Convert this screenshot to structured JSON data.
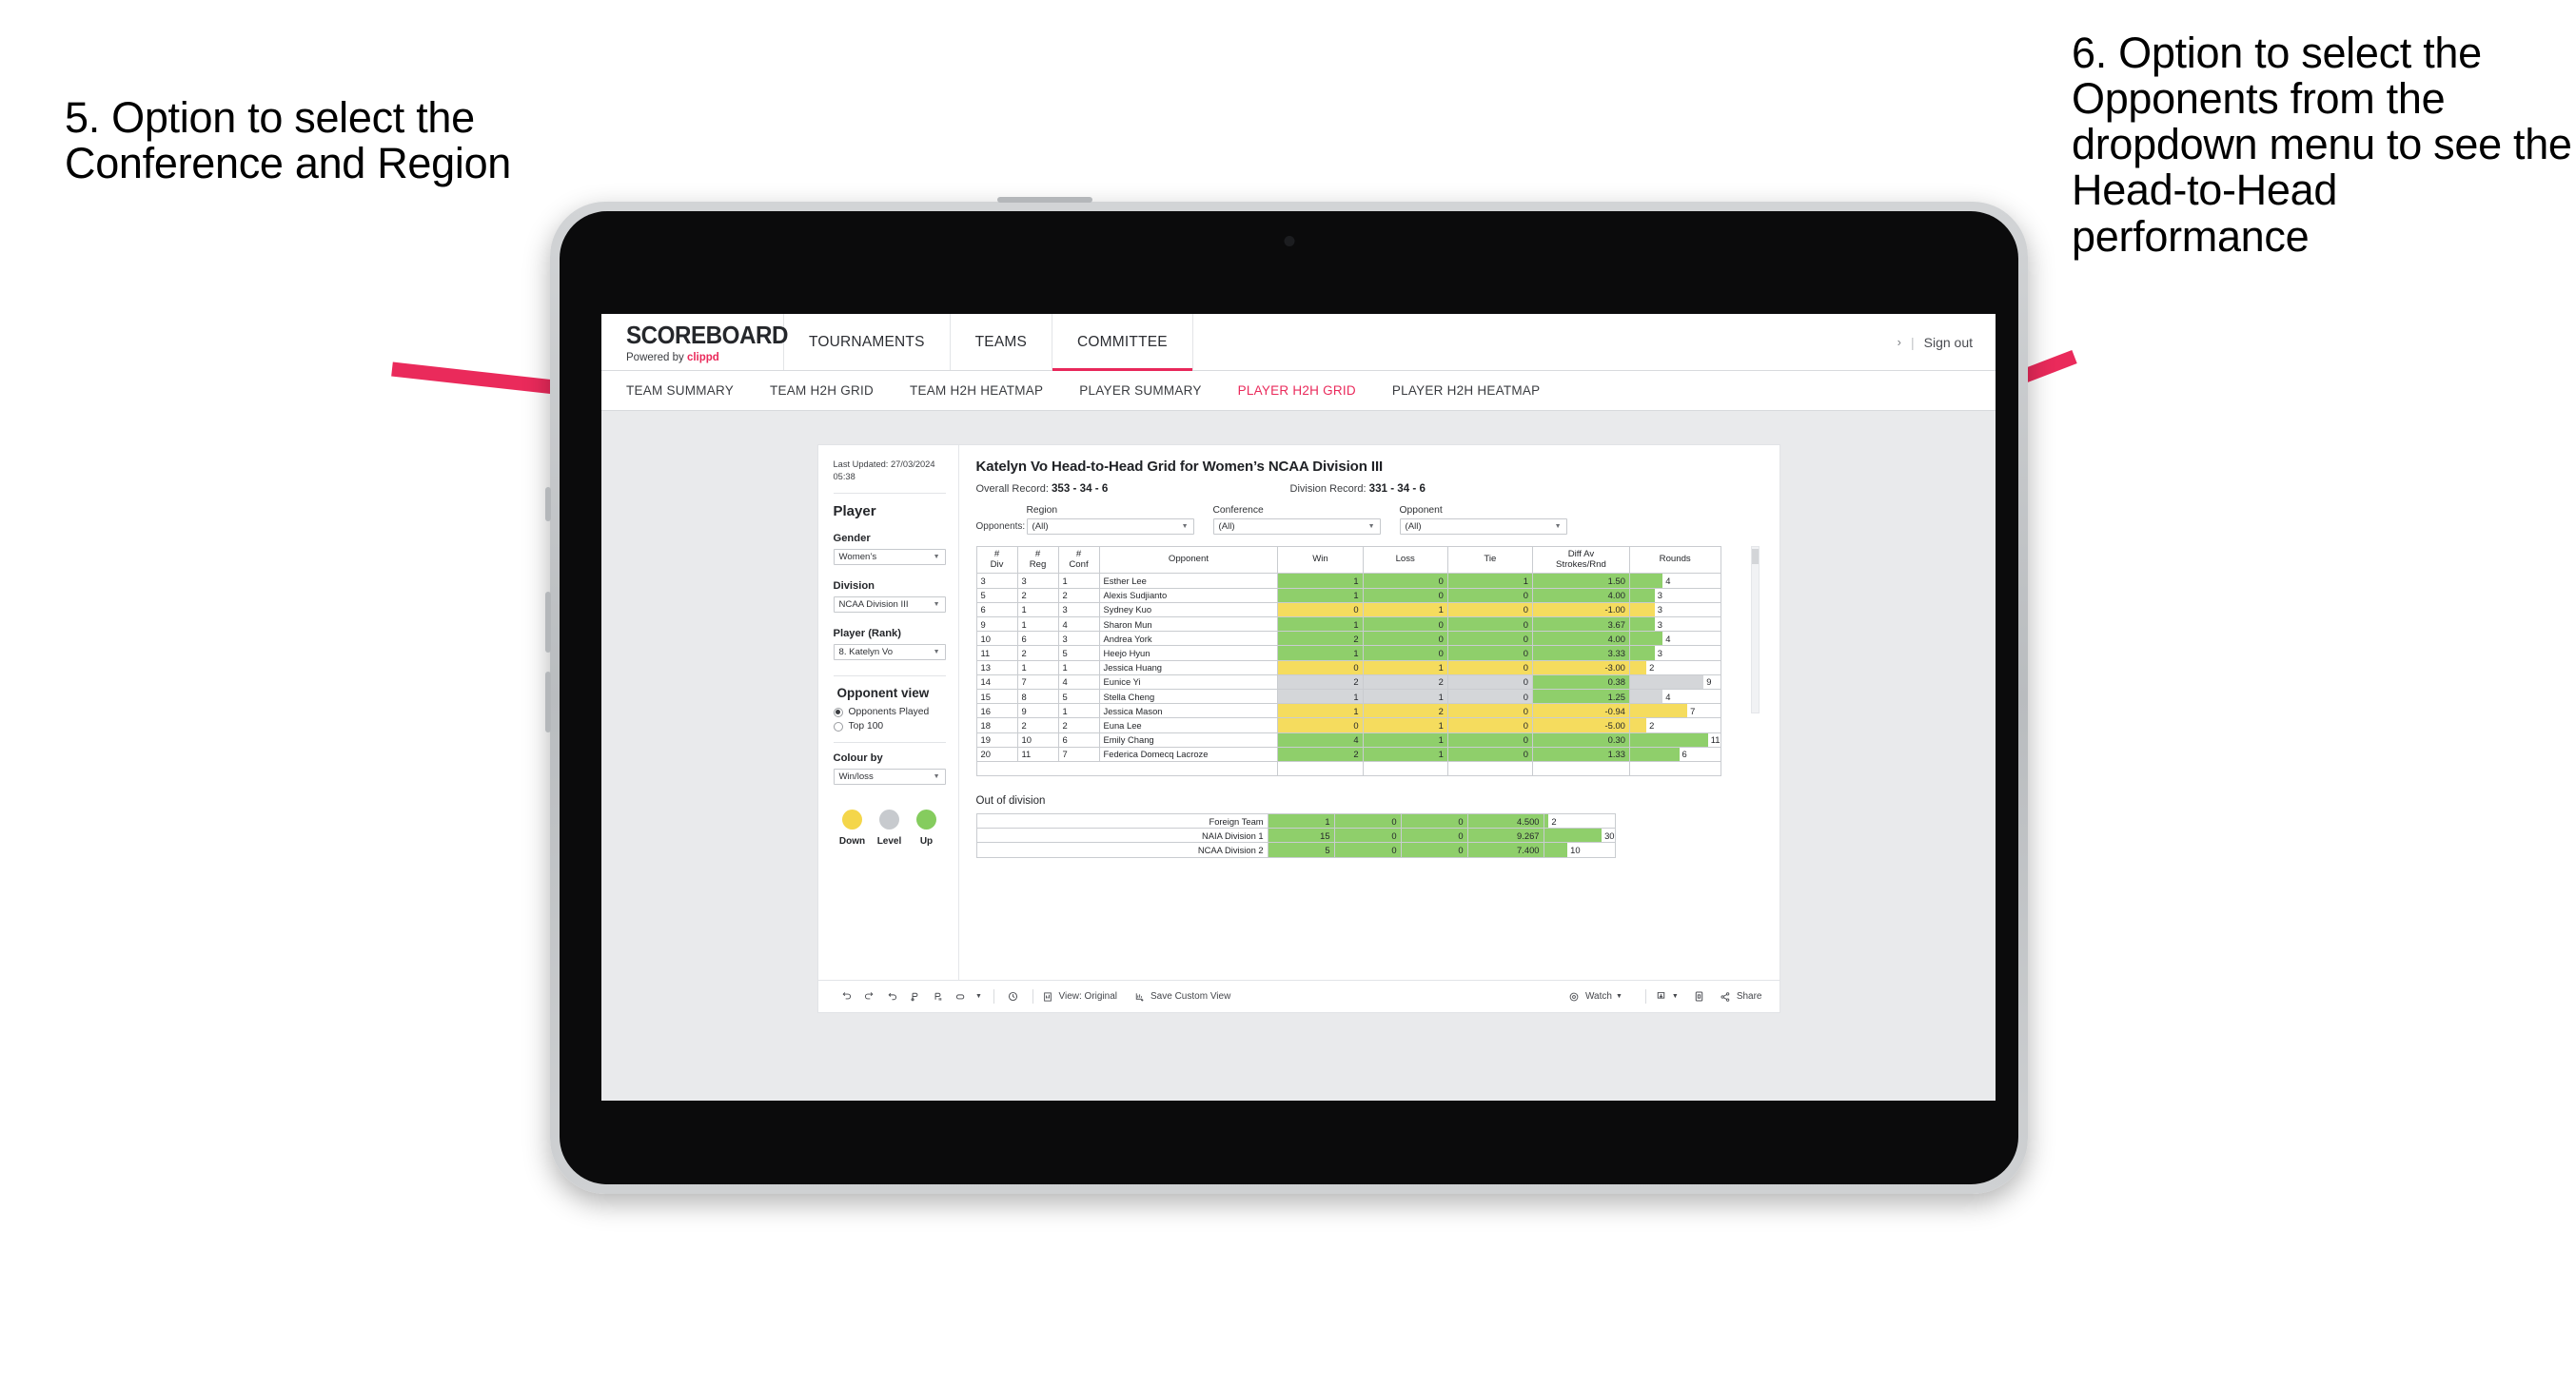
{
  "annotations": {
    "left": "5. Option to select the Conference and Region",
    "right": "6. Option to select the Opponents from the dropdown menu to see the Head-to-Head performance",
    "arrow_color": "#ea2a5b"
  },
  "app": {
    "brand": {
      "name": "SCOREBOARD",
      "powered_prefix": "Powered by",
      "powered_brand": "clippd"
    },
    "top_nav": [
      {
        "label": "TOURNAMENTS",
        "active": false
      },
      {
        "label": "TEAMS",
        "active": false
      },
      {
        "label": "COMMITTEE",
        "active": true
      }
    ],
    "top_right": {
      "chevron": "›",
      "separator": "|",
      "sign_out": "Sign out"
    },
    "sub_nav": [
      {
        "label": "TEAM SUMMARY",
        "active": false
      },
      {
        "label": "TEAM H2H GRID",
        "active": false
      },
      {
        "label": "TEAM H2H HEATMAP",
        "active": false
      },
      {
        "label": "PLAYER SUMMARY",
        "active": false
      },
      {
        "label": "PLAYER H2H GRID",
        "active": true
      },
      {
        "label": "PLAYER H2H HEATMAP",
        "active": false
      }
    ]
  },
  "sidebar": {
    "last_updated": "Last Updated: 27/03/2024 05:38",
    "player_heading": "Player",
    "gender": {
      "label": "Gender",
      "value": "Women’s"
    },
    "division": {
      "label": "Division",
      "value": "NCAA Division III"
    },
    "player_rank": {
      "label": "Player (Rank)",
      "value": "8. Katelyn Vo"
    },
    "opponent_view": {
      "heading": "Opponent view",
      "options": [
        {
          "label": "Opponents Played",
          "selected": true
        },
        {
          "label": "Top 100",
          "selected": false
        }
      ]
    },
    "colour_by": {
      "label": "Colour by",
      "value": "Win/loss"
    },
    "legend": [
      {
        "label": "Down",
        "color": "#f4d64a"
      },
      {
        "label": "Level",
        "color": "#c7cace"
      },
      {
        "label": "Up",
        "color": "#85cc5e"
      }
    ]
  },
  "main": {
    "title": "Katelyn Vo Head-to-Head Grid for Women’s NCAA Division III",
    "overall_record": {
      "label": "Overall Record:",
      "value": "353 - 34 - 6"
    },
    "division_record": {
      "label": "Division Record:",
      "value": "331 - 34 - 6"
    },
    "opponents_label": "Opponents:",
    "filters": [
      {
        "caption": "Region",
        "value": "(All)"
      },
      {
        "caption": "Conference",
        "value": "(All)"
      },
      {
        "caption": "Opponent",
        "value": "(All)"
      }
    ],
    "out_of_division_title": "Out of division"
  },
  "chart_data": {
    "type": "table",
    "title": "Katelyn Vo Head-to-Head Grid for Women’s NCAA Division III",
    "columns": [
      "# Div",
      "# Reg",
      "# Conf",
      "Opponent",
      "Win",
      "Loss",
      "Tie",
      "Diff Av Strokes/Rnd",
      "Rounds"
    ],
    "column_header_lines": [
      [
        "#",
        "Div"
      ],
      [
        "#",
        "Reg"
      ],
      [
        "#",
        "Conf"
      ],
      [
        "Opponent"
      ],
      [
        "Win"
      ],
      [
        "Loss"
      ],
      [
        "Tie"
      ],
      [
        "Diff Av",
        "Strokes/Rnd"
      ],
      [
        "Rounds"
      ]
    ],
    "rounds_max": 11,
    "colors": {
      "up": "#8fcf6b",
      "down": "#f5dc5e",
      "level": "#d4d6d9"
    },
    "rows": [
      {
        "div": "3",
        "reg": "3",
        "conf": "1",
        "opponent": "Esther Lee",
        "win": "1",
        "loss": "0",
        "tie": "1",
        "diff": "1.50",
        "rounds": "4",
        "state": "up"
      },
      {
        "div": "5",
        "reg": "2",
        "conf": "2",
        "opponent": "Alexis Sudjianto",
        "win": "1",
        "loss": "0",
        "tie": "0",
        "diff": "4.00",
        "rounds": "3",
        "state": "up"
      },
      {
        "div": "6",
        "reg": "1",
        "conf": "3",
        "opponent": "Sydney Kuo",
        "win": "0",
        "loss": "1",
        "tie": "0",
        "diff": "-1.00",
        "rounds": "3",
        "state": "down"
      },
      {
        "div": "9",
        "reg": "1",
        "conf": "4",
        "opponent": "Sharon Mun",
        "win": "1",
        "loss": "0",
        "tie": "0",
        "diff": "3.67",
        "rounds": "3",
        "state": "up"
      },
      {
        "div": "10",
        "reg": "6",
        "conf": "3",
        "opponent": "Andrea York",
        "win": "2",
        "loss": "0",
        "tie": "0",
        "diff": "4.00",
        "rounds": "4",
        "state": "up"
      },
      {
        "div": "11",
        "reg": "2",
        "conf": "5",
        "opponent": "Heejo Hyun",
        "win": "1",
        "loss": "0",
        "tie": "0",
        "diff": "3.33",
        "rounds": "3",
        "state": "up"
      },
      {
        "div": "13",
        "reg": "1",
        "conf": "1",
        "opponent": "Jessica Huang",
        "win": "0",
        "loss": "1",
        "tie": "0",
        "diff": "-3.00",
        "rounds": "2",
        "state": "down"
      },
      {
        "div": "14",
        "reg": "7",
        "conf": "4",
        "opponent": "Eunice Yi",
        "win": "2",
        "loss": "2",
        "tie": "0",
        "diff": "0.38",
        "rounds": "9",
        "state": "level",
        "diff_state": "up"
      },
      {
        "div": "15",
        "reg": "8",
        "conf": "5",
        "opponent": "Stella Cheng",
        "win": "1",
        "loss": "1",
        "tie": "0",
        "diff": "1.25",
        "rounds": "4",
        "state": "level",
        "diff_state": "up"
      },
      {
        "div": "16",
        "reg": "9",
        "conf": "1",
        "opponent": "Jessica Mason",
        "win": "1",
        "loss": "2",
        "tie": "0",
        "diff": "-0.94",
        "rounds": "7",
        "state": "down"
      },
      {
        "div": "18",
        "reg": "2",
        "conf": "2",
        "opponent": "Euna Lee",
        "win": "0",
        "loss": "1",
        "tie": "0",
        "diff": "-5.00",
        "rounds": "2",
        "state": "down"
      },
      {
        "div": "19",
        "reg": "10",
        "conf": "6",
        "opponent": "Emily Chang",
        "win": "4",
        "loss": "1",
        "tie": "0",
        "diff": "0.30",
        "rounds": "11",
        "state": "up"
      },
      {
        "div": "20",
        "reg": "11",
        "conf": "7",
        "opponent": "Federica Domecq Lacroze",
        "win": "2",
        "loss": "1",
        "tie": "0",
        "diff": "1.33",
        "rounds": "6",
        "state": "up"
      }
    ],
    "out_of_division": {
      "title": "Out of division",
      "rounds_max": 30,
      "rows": [
        {
          "name": "Foreign Team",
          "win": "1",
          "loss": "0",
          "tie": "0",
          "diff": "4.500",
          "rounds": "2",
          "state": "up"
        },
        {
          "name": "NAIA Division 1",
          "win": "15",
          "loss": "0",
          "tie": "0",
          "diff": "9.267",
          "rounds": "30",
          "state": "up"
        },
        {
          "name": "NCAA Division 2",
          "win": "5",
          "loss": "0",
          "tie": "0",
          "diff": "7.400",
          "rounds": "10",
          "state": "up"
        }
      ]
    }
  },
  "toolbar": {
    "icons": [
      "undo-icon",
      "redo-icon",
      "revert-icon",
      "refresh-icon",
      "pause-icon",
      "shape-icon",
      "caret-icon",
      "history-icon"
    ],
    "view_label": "View: Original",
    "save_label": "Save Custom View",
    "watch_label": "Watch",
    "share_label": "Share",
    "download_icon": "download-icon",
    "fullscreen_icon": "fullscreen-icon"
  }
}
